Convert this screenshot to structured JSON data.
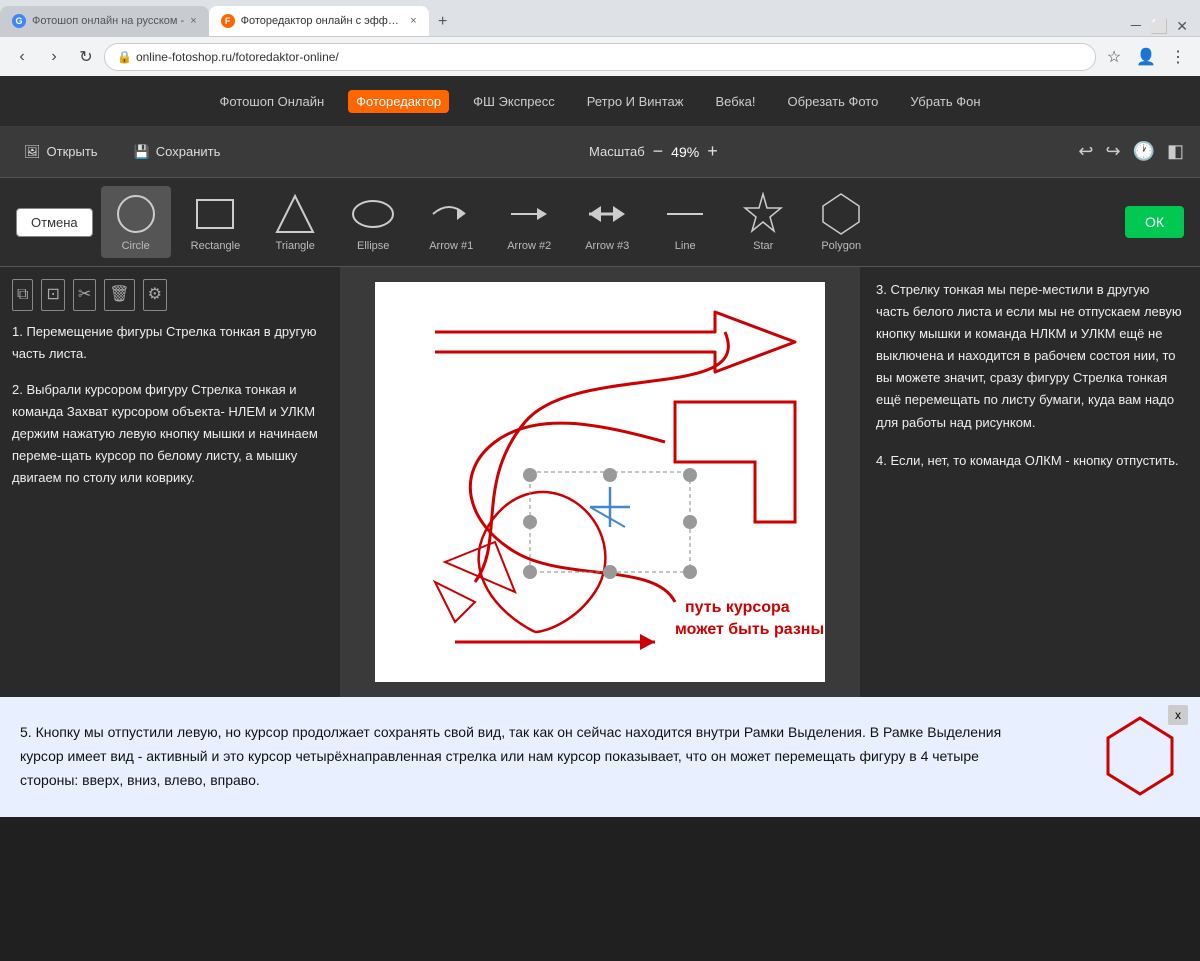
{
  "browser": {
    "tabs": [
      {
        "label": "Фотошоп онлайн на русском -",
        "favicon": "G",
        "active": false
      },
      {
        "label": "Фоторедактор онлайн с эффект...",
        "favicon": "F",
        "active": true
      }
    ],
    "address": "online-fotoshop.ru/fotoredaktor-online/"
  },
  "site_nav": {
    "items": [
      {
        "label": "Фотошоп Онлайн",
        "active": false
      },
      {
        "label": "Фоторедактор",
        "active": true
      },
      {
        "label": "ФШ Экспресс",
        "active": false
      },
      {
        "label": "Ретро И Винтаж",
        "active": false
      },
      {
        "label": "Вебка!",
        "active": false
      },
      {
        "label": "Обрезать Фото",
        "active": false
      },
      {
        "label": "Убрать Фон",
        "active": false
      }
    ]
  },
  "toolbar": {
    "open_label": "Открыть",
    "save_label": "Сохранить",
    "scale_label": "Масштаб",
    "scale_value": "49%",
    "minus": "−",
    "plus": "+"
  },
  "shape_selector": {
    "cancel_label": "Отмена",
    "ok_label": "ОК",
    "shapes": [
      {
        "id": "circle",
        "label": "Circle",
        "selected": true
      },
      {
        "id": "rectangle",
        "label": "Rectangle",
        "selected": false
      },
      {
        "id": "triangle",
        "label": "Triangle",
        "selected": false
      },
      {
        "id": "ellipse",
        "label": "Ellipse",
        "selected": false
      },
      {
        "id": "arrow1",
        "label": "Arrow #1",
        "selected": false
      },
      {
        "id": "arrow2",
        "label": "Arrow #2",
        "selected": false
      },
      {
        "id": "arrow3",
        "label": "Arrow #3",
        "selected": false
      },
      {
        "id": "line",
        "label": "Line",
        "selected": false
      },
      {
        "id": "star",
        "label": "Star",
        "selected": false
      },
      {
        "id": "polygon",
        "label": "Polygon",
        "selected": false
      }
    ]
  },
  "left_text": {
    "p1": "1. Перемещение фигуры Стрелка тонкая в другую часть листа.",
    "p2": "2. Выбрали курсором фигуру Стрелка тонкая и команда Захват курсором объекта- НЛЕМ и УЛКМ держим нажатую левую кнопку мышки и начинаем переме-щать курсор по белому листу, а мышку двигаем по столу или коврику."
  },
  "canvas_text": {
    "cursor_path": "путь курсора\nможет быть разный"
  },
  "right_text": {
    "content": "3. Стрелку тонкая мы пере-местили в другую часть белого листа и если мы не отпускаем левую кнопку мышки и команда НЛКМ и УЛКМ ещё не выключена и находится в рабочем состоя нии, то вы можете значит, сразу фигуру Стрелка тонкая ещё перемещать по листу бумаги, куда вам надо для работы над рисунком.",
    "p4": "4. Если, нет, то команда ОЛКМ - кнопку отпустить."
  },
  "bottom_text": {
    "content": "5. Кнопку мы отпустили левую, но курсор продолжает сохранять свой вид, так как он сейчас находится внутри Рамки Выделения. В Рамке Выделения курсор имеет вид - активный и это курсор четырёхнаправленная стрелка или нам курсор показывает, что он может перемещать фигуру в 4 четыре стороны: вверх, вниз, влево, вправо.",
    "close": "x"
  }
}
